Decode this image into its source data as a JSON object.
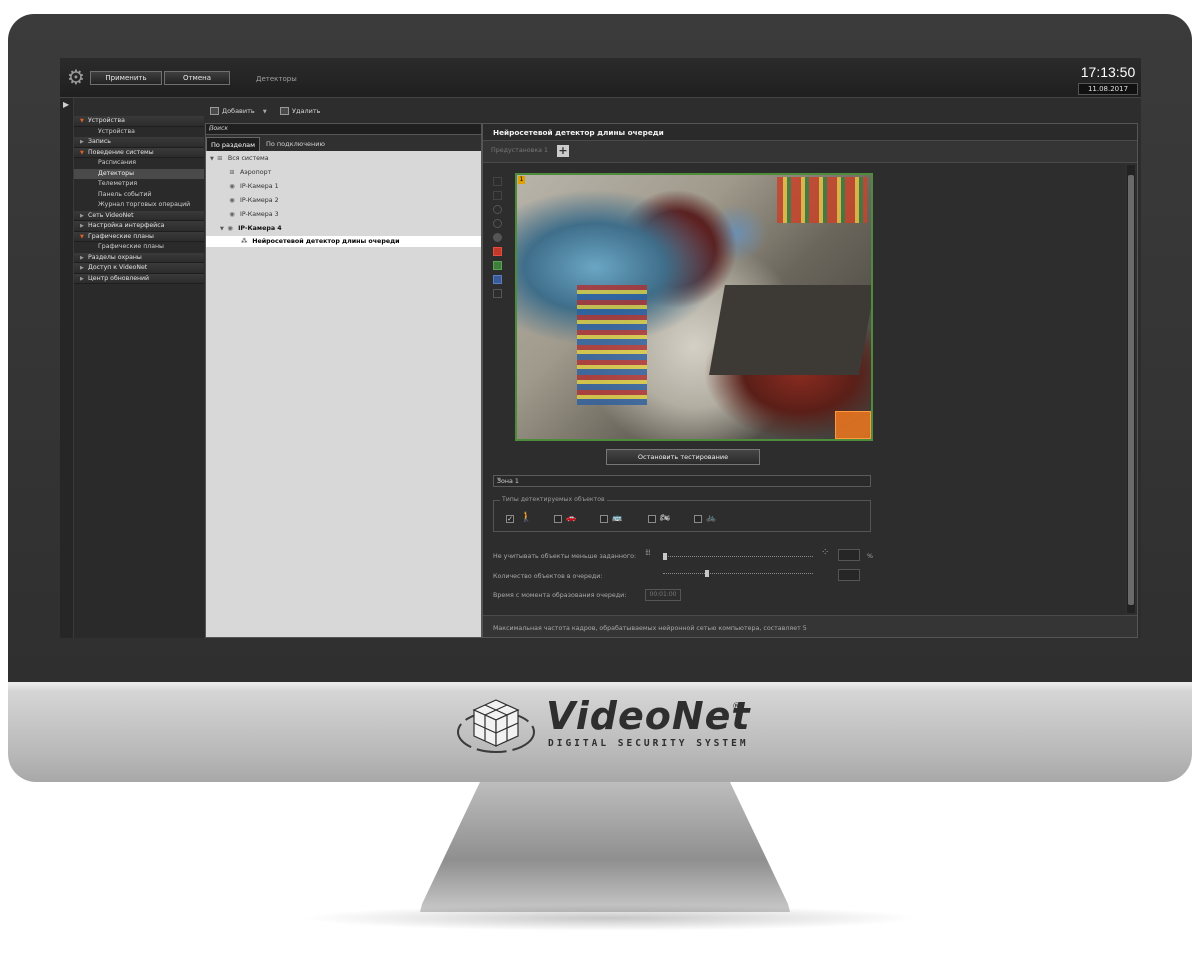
{
  "topbar": {
    "apply_label": "Применить",
    "cancel_label": "Отмена",
    "section_title": "Детекторы",
    "time": "17:13:50",
    "date": "11.08.2017"
  },
  "toolbar": {
    "add_label": "Добавить",
    "delete_label": "Удалить"
  },
  "nav": {
    "items": [
      {
        "label": "Устройства",
        "type": "group",
        "open": true
      },
      {
        "label": "Устройства",
        "type": "sub"
      },
      {
        "label": "Запись",
        "type": "group",
        "open": false
      },
      {
        "label": "Поведение системы",
        "type": "group",
        "open": true
      },
      {
        "label": "Расписания",
        "type": "sub"
      },
      {
        "label": "Детекторы",
        "type": "sub",
        "active": true
      },
      {
        "label": "Телеметрия",
        "type": "sub"
      },
      {
        "label": "Панель событий",
        "type": "sub"
      },
      {
        "label": "Журнал торговых операций",
        "type": "sub"
      },
      {
        "label": "Сеть VideoNet",
        "type": "group",
        "open": false
      },
      {
        "label": "Настройка интерфейса",
        "type": "group",
        "open": false
      },
      {
        "label": "Графические планы",
        "type": "group",
        "open": true
      },
      {
        "label": "Графические планы",
        "type": "sub"
      },
      {
        "label": "Разделы охраны",
        "type": "group",
        "open": false
      },
      {
        "label": "Доступ к VideoNet",
        "type": "group",
        "open": false
      },
      {
        "label": "Центр обновлений",
        "type": "group",
        "open": false
      }
    ]
  },
  "tree_panel": {
    "search_placeholder": "Поиск",
    "tab_sections": "По разделам",
    "tab_connection": "По подключению",
    "items": {
      "all_system": "Вся система",
      "airport": "Аэропорт",
      "cam1": "IP-Камера 1",
      "cam2": "IP-Камера 2",
      "cam3": "IP-Камера 3",
      "cam4": "IP-Камера 4",
      "detector": "Нейросетевой детектор длины очереди"
    }
  },
  "detail": {
    "title": "Нейросетевой детектор длины очереди",
    "preset_tab": "Предустановка 1",
    "video_number": "1",
    "stop_button": "Остановить тестирование",
    "zone_value": "Зона 1",
    "types_legend": "Типы детектируемых объектов",
    "object_types": [
      {
        "name": "person",
        "checked": true
      },
      {
        "name": "car",
        "checked": false
      },
      {
        "name": "bus",
        "checked": false
      },
      {
        "name": "motorcycle",
        "checked": false
      },
      {
        "name": "bicycle",
        "checked": false
      }
    ],
    "min_size_label": "Не учитывать объекты меньше заданного:",
    "min_size_unit": "%",
    "queue_count_label": "Количество объектов в очереди:",
    "queue_time_label": "Время с момента образования очереди:",
    "queue_time_value": "00:01:00",
    "footer_text": "Максимальная частота кадров, обрабатываемых нейронной сетью компьютера, составляет 5"
  },
  "brand": {
    "name": "VideoNet",
    "tagline": "DIGITAL SECURITY SYSTEM",
    "registered": "®"
  }
}
